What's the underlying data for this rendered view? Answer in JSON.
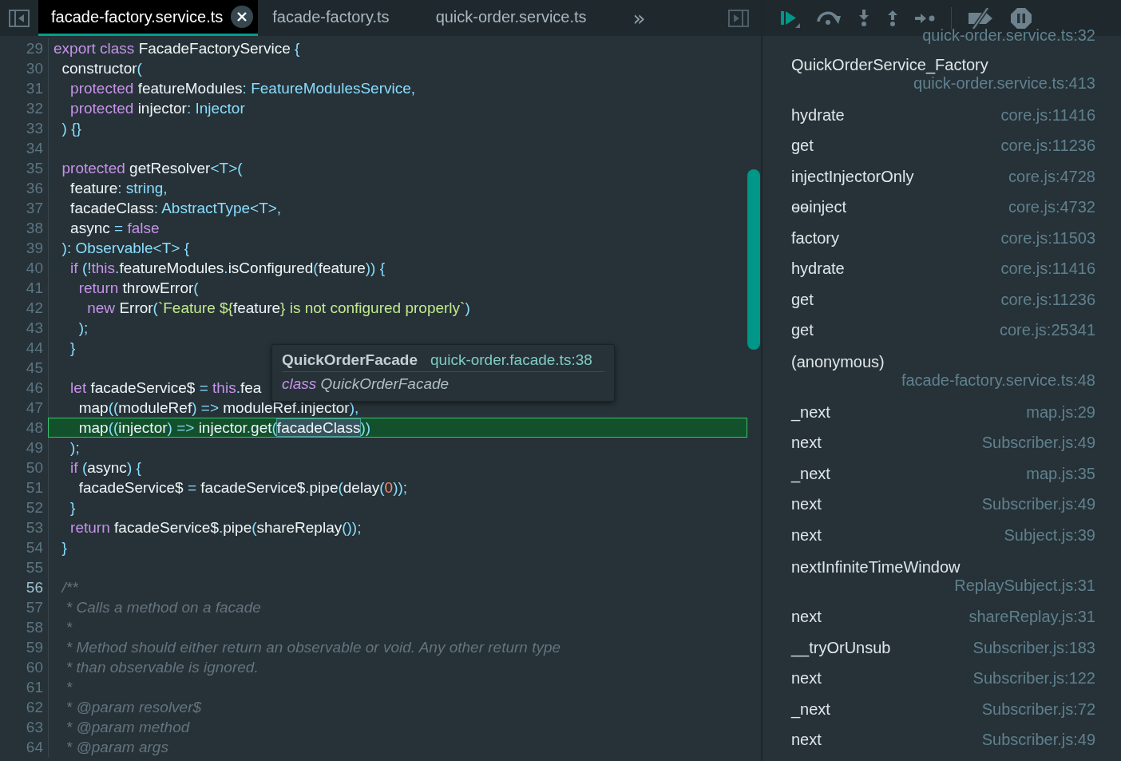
{
  "tabs": [
    {
      "label": "facade-factory.service.ts",
      "selected": true,
      "closable": true
    },
    {
      "label": "facade-factory.ts",
      "selected": false,
      "closable": false
    },
    {
      "label": "quick-order.service.ts",
      "selected": false,
      "closable": false
    }
  ],
  "tab_overflow": "»",
  "editor": {
    "lines": [
      {
        "number": "29",
        "paused": false,
        "cursor": false,
        "tokens": [
          {
            "kind": "k",
            "text": "export class "
          },
          {
            "kind": "p",
            "text": "FacadeFactoryService "
          },
          {
            "kind": "t",
            "text": "{"
          }
        ]
      },
      {
        "number": "30",
        "paused": false,
        "cursor": false,
        "tokens": [
          {
            "kind": "p",
            "text": "  constructor"
          },
          {
            "kind": "t",
            "text": "("
          }
        ]
      },
      {
        "number": "31",
        "paused": false,
        "cursor": false,
        "tokens": [
          {
            "kind": "k",
            "text": "    protected "
          },
          {
            "kind": "p",
            "text": "featureModules"
          },
          {
            "kind": "t",
            "text": ": FeatureModulesService,"
          }
        ]
      },
      {
        "number": "32",
        "paused": false,
        "cursor": false,
        "tokens": [
          {
            "kind": "k",
            "text": "    protected "
          },
          {
            "kind": "p",
            "text": "injector"
          },
          {
            "kind": "t",
            "text": ": Injector"
          }
        ]
      },
      {
        "number": "33",
        "paused": false,
        "cursor": false,
        "tokens": [
          {
            "kind": "t",
            "text": "  ) {}"
          }
        ]
      },
      {
        "number": "34",
        "paused": false,
        "cursor": false
      },
      {
        "number": "35",
        "paused": false,
        "cursor": false,
        "tokens": [
          {
            "kind": "k",
            "text": "  protected "
          },
          {
            "kind": "p",
            "text": "getResolver"
          },
          {
            "kind": "t",
            "text": "<T>("
          }
        ]
      },
      {
        "number": "36",
        "paused": false,
        "cursor": false,
        "tokens": [
          {
            "kind": "p",
            "text": "    feature"
          },
          {
            "kind": "t",
            "text": ": string,"
          }
        ]
      },
      {
        "number": "37",
        "paused": false,
        "cursor": false,
        "tokens": [
          {
            "kind": "p",
            "text": "    facadeClass"
          },
          {
            "kind": "t",
            "text": ": AbstractType<T>,"
          }
        ]
      },
      {
        "number": "38",
        "paused": false,
        "cursor": false,
        "tokens": [
          {
            "kind": "p",
            "text": "    async "
          },
          {
            "kind": "t",
            "text": "= "
          },
          {
            "kind": "k",
            "text": "false"
          }
        ]
      },
      {
        "number": "39",
        "paused": false,
        "cursor": false,
        "tokens": [
          {
            "kind": "t",
            "text": "  ): Observable<T> {"
          }
        ]
      },
      {
        "number": "40",
        "paused": false,
        "cursor": false,
        "tokens": [
          {
            "kind": "k",
            "text": "    if "
          },
          {
            "kind": "t",
            "text": "(!"
          },
          {
            "kind": "k",
            "text": "this"
          },
          {
            "kind": "t",
            "text": "."
          },
          {
            "kind": "p",
            "text": "featureModules"
          },
          {
            "kind": "t",
            "text": "."
          },
          {
            "kind": "p",
            "text": "isConfigured"
          },
          {
            "kind": "t",
            "text": "("
          },
          {
            "kind": "p",
            "text": "feature"
          },
          {
            "kind": "t",
            "text": ")) {"
          }
        ]
      },
      {
        "number": "41",
        "paused": false,
        "cursor": false,
        "tokens": [
          {
            "kind": "k",
            "text": "      return "
          },
          {
            "kind": "p",
            "text": "throwError"
          },
          {
            "kind": "t",
            "text": "("
          }
        ]
      },
      {
        "number": "42",
        "paused": false,
        "cursor": false,
        "tokens": [
          {
            "kind": "k",
            "text": "        new "
          },
          {
            "kind": "p",
            "text": "Error"
          },
          {
            "kind": "t",
            "text": "("
          },
          {
            "kind": "s",
            "text": "`Feature ${"
          },
          {
            "kind": "p",
            "text": "feature"
          },
          {
            "kind": "s",
            "text": "} is not configured properly`"
          },
          {
            "kind": "t",
            "text": ")"
          }
        ]
      },
      {
        "number": "43",
        "paused": false,
        "cursor": false,
        "tokens": [
          {
            "kind": "t",
            "text": "      );"
          }
        ]
      },
      {
        "number": "44",
        "paused": false,
        "cursor": false,
        "tokens": [
          {
            "kind": "t",
            "text": "    }"
          }
        ]
      },
      {
        "number": "45",
        "paused": false,
        "cursor": false
      },
      {
        "number": "46",
        "paused": false,
        "cursor": false,
        "tokens": [
          {
            "kind": "k",
            "text": "    let "
          },
          {
            "kind": "p",
            "text": "facadeService$ "
          },
          {
            "kind": "t",
            "text": "= "
          },
          {
            "kind": "k",
            "text": "this"
          },
          {
            "kind": "t",
            "text": "."
          },
          {
            "kind": "p",
            "text": "fea"
          }
        ]
      },
      {
        "number": "47",
        "paused": false,
        "cursor": false,
        "tokens": [
          {
            "kind": "p",
            "text": "      map"
          },
          {
            "kind": "t",
            "text": "(("
          },
          {
            "kind": "p",
            "text": "moduleRef"
          },
          {
            "kind": "t",
            "text": ") => "
          },
          {
            "kind": "p",
            "text": "moduleRef.injector"
          },
          {
            "kind": "t",
            "text": "),"
          }
        ]
      },
      {
        "number": "48",
        "paused": true,
        "cursor": false,
        "tokens": [
          {
            "kind": "p",
            "text": "      map"
          },
          {
            "kind": "t",
            "text": "(("
          },
          {
            "kind": "p",
            "text": "injector"
          },
          {
            "kind": "t",
            "text": ") => "
          },
          {
            "kind": "p",
            "text": "injector"
          },
          {
            "kind": "t",
            "text": "."
          },
          {
            "kind": "p",
            "text": "get"
          },
          {
            "kind": "t",
            "text": "("
          },
          {
            "kind": "sel",
            "text": "facadeClass"
          },
          {
            "kind": "t",
            "text": "))"
          }
        ]
      },
      {
        "number": "49",
        "paused": false,
        "cursor": false,
        "tokens": [
          {
            "kind": "t",
            "text": "    );"
          }
        ]
      },
      {
        "number": "50",
        "paused": false,
        "cursor": false,
        "tokens": [
          {
            "kind": "k",
            "text": "    if "
          },
          {
            "kind": "t",
            "text": "("
          },
          {
            "kind": "p",
            "text": "async"
          },
          {
            "kind": "t",
            "text": ") {"
          }
        ]
      },
      {
        "number": "51",
        "paused": false,
        "cursor": false,
        "tokens": [
          {
            "kind": "p",
            "text": "      facadeService$ "
          },
          {
            "kind": "t",
            "text": "= "
          },
          {
            "kind": "p",
            "text": "facadeService$"
          },
          {
            "kind": "t",
            "text": "."
          },
          {
            "kind": "p",
            "text": "pipe"
          },
          {
            "kind": "t",
            "text": "("
          },
          {
            "kind": "p",
            "text": "delay"
          },
          {
            "kind": "t",
            "text": "("
          },
          {
            "kind": "n",
            "text": "0"
          },
          {
            "kind": "t",
            "text": "));"
          }
        ]
      },
      {
        "number": "52",
        "paused": false,
        "cursor": false,
        "tokens": [
          {
            "kind": "t",
            "text": "    }"
          }
        ]
      },
      {
        "number": "53",
        "paused": false,
        "cursor": false,
        "tokens": [
          {
            "kind": "k",
            "text": "    return "
          },
          {
            "kind": "p",
            "text": "facadeService$"
          },
          {
            "kind": "t",
            "text": "."
          },
          {
            "kind": "p",
            "text": "pipe"
          },
          {
            "kind": "t",
            "text": "("
          },
          {
            "kind": "p",
            "text": "shareReplay"
          },
          {
            "kind": "t",
            "text": "());"
          }
        ]
      },
      {
        "number": "54",
        "paused": false,
        "cursor": false,
        "tokens": [
          {
            "kind": "t",
            "text": "  }"
          }
        ]
      },
      {
        "number": "55",
        "paused": false,
        "cursor": false
      },
      {
        "number": "56",
        "paused": false,
        "cursor": true,
        "tokens": [
          {
            "kind": "c",
            "text": "  /**"
          }
        ]
      },
      {
        "number": "57",
        "paused": false,
        "cursor": false,
        "tokens": [
          {
            "kind": "c",
            "text": "   * Calls a method on a facade"
          }
        ]
      },
      {
        "number": "58",
        "paused": false,
        "cursor": false,
        "tokens": [
          {
            "kind": "c",
            "text": "   *"
          }
        ]
      },
      {
        "number": "59",
        "paused": false,
        "cursor": false,
        "tokens": [
          {
            "kind": "c",
            "text": "   * Method should either return an observable or void. Any other return type"
          }
        ]
      },
      {
        "number": "60",
        "paused": false,
        "cursor": false,
        "tokens": [
          {
            "kind": "c",
            "text": "   * than observable is ignored."
          }
        ]
      },
      {
        "number": "61",
        "paused": false,
        "cursor": false,
        "tokens": [
          {
            "kind": "c",
            "text": "   *"
          }
        ]
      },
      {
        "number": "62",
        "paused": false,
        "cursor": false,
        "tokens": [
          {
            "kind": "c",
            "text": "   * @param resolver$"
          }
        ]
      },
      {
        "number": "63",
        "paused": false,
        "cursor": false,
        "tokens": [
          {
            "kind": "c",
            "text": "   * @param method"
          }
        ]
      },
      {
        "number": "64",
        "paused": false,
        "cursor": false,
        "tokens": [
          {
            "kind": "c",
            "text": "   * @param args"
          }
        ]
      }
    ],
    "tooltip": {
      "name": "QuickOrderFacade",
      "location": "quick-order.facade.ts:38",
      "keyword": "class",
      "signature": "QuickOrderFacade"
    }
  },
  "call_stack": {
    "top_location": "quick-order.service.ts:32",
    "frames": [
      {
        "name": "QuickOrderService_Factory",
        "location": "quick-order.service.ts:413",
        "kind": "wrapped"
      },
      {
        "name": "hydrate",
        "location": "core.js:11416",
        "kind": "inline"
      },
      {
        "name": "get",
        "location": "core.js:11236",
        "kind": "inline"
      },
      {
        "name": "injectInjectorOnly",
        "location": "core.js:4728",
        "kind": "inline"
      },
      {
        "name": "ɵɵinject",
        "location": "core.js:4732",
        "kind": "inline"
      },
      {
        "name": "factory",
        "location": "core.js:11503",
        "kind": "inline"
      },
      {
        "name": "hydrate",
        "location": "core.js:11416",
        "kind": "inline"
      },
      {
        "name": "get",
        "location": "core.js:11236",
        "kind": "inline"
      },
      {
        "name": "get",
        "location": "core.js:25341",
        "kind": "inline"
      },
      {
        "name": "(anonymous)",
        "location": "facade-factory.service.ts:48",
        "kind": "wrapped"
      },
      {
        "name": "_next",
        "location": "map.js:29",
        "kind": "inline"
      },
      {
        "name": "next",
        "location": "Subscriber.js:49",
        "kind": "inline"
      },
      {
        "name": "_next",
        "location": "map.js:35",
        "kind": "inline"
      },
      {
        "name": "next",
        "location": "Subscriber.js:49",
        "kind": "inline"
      },
      {
        "name": "next",
        "location": "Subject.js:39",
        "kind": "inline"
      },
      {
        "name": "nextInfiniteTimeWindow",
        "location": "ReplaySubject.js:31",
        "kind": "wrapped"
      },
      {
        "name": "next",
        "location": "shareReplay.js:31",
        "kind": "inline"
      },
      {
        "name": "__tryOrUnsub",
        "location": "Subscriber.js:183",
        "kind": "inline"
      },
      {
        "name": "next",
        "location": "Subscriber.js:122",
        "kind": "inline"
      },
      {
        "name": "_next",
        "location": "Subscriber.js:72",
        "kind": "inline"
      },
      {
        "name": "next",
        "location": "Subscriber.js:49",
        "kind": "inline"
      }
    ]
  }
}
